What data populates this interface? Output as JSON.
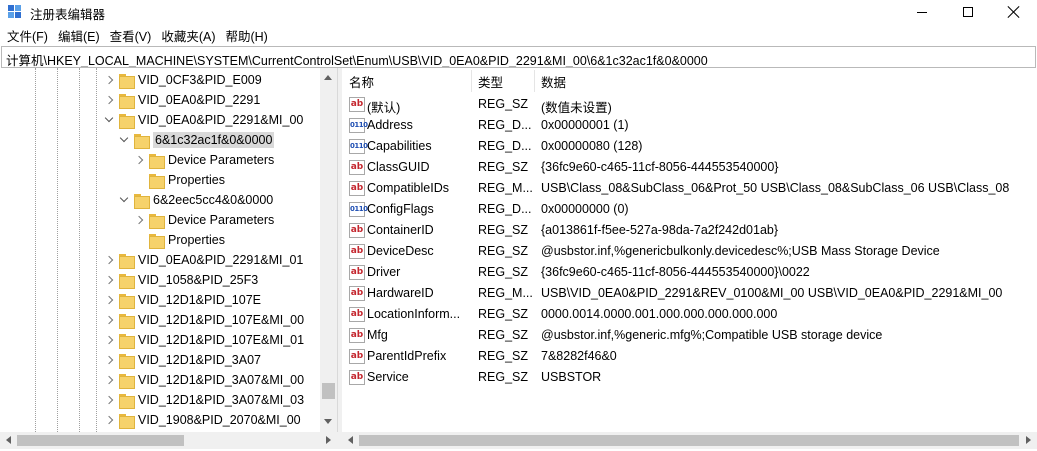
{
  "window": {
    "title": "注册表编辑器",
    "app_icon": "regedit-icon",
    "controls": [
      "minimize-icon",
      "maximize-icon",
      "close-icon"
    ]
  },
  "menu": [
    "文件(F)",
    "编辑(E)",
    "查看(V)",
    "收藏夹(A)",
    "帮助(H)"
  ],
  "address": "计算机\\HKEY_LOCAL_MACHINE\\SYSTEM\\CurrentControlSet\\Enum\\USB\\VID_0EA0&PID_2291&MI_00\\6&1c32ac1f&0&0000",
  "tree": [
    {
      "label": "VID_0CF3&PID_E009",
      "depth": 0,
      "expander": "right",
      "selected": false
    },
    {
      "label": "VID_0EA0&PID_2291",
      "depth": 0,
      "expander": "right",
      "selected": false
    },
    {
      "label": "VID_0EA0&PID_2291&MI_00",
      "depth": 0,
      "expander": "down",
      "selected": false
    },
    {
      "label": "6&1c32ac1f&0&0000",
      "depth": 1,
      "expander": "down",
      "selected": true
    },
    {
      "label": "Device Parameters",
      "depth": 2,
      "expander": "right",
      "selected": false
    },
    {
      "label": "Properties",
      "depth": 2,
      "expander": "none",
      "selected": false
    },
    {
      "label": "6&2eec5cc4&0&0000",
      "depth": 1,
      "expander": "down",
      "selected": false
    },
    {
      "label": "Device Parameters",
      "depth": 2,
      "expander": "right",
      "selected": false
    },
    {
      "label": "Properties",
      "depth": 2,
      "expander": "none",
      "selected": false
    },
    {
      "label": "VID_0EA0&PID_2291&MI_01",
      "depth": 0,
      "expander": "right",
      "selected": false
    },
    {
      "label": "VID_1058&PID_25F3",
      "depth": 0,
      "expander": "right",
      "selected": false
    },
    {
      "label": "VID_12D1&PID_107E",
      "depth": 0,
      "expander": "right",
      "selected": false
    },
    {
      "label": "VID_12D1&PID_107E&MI_00",
      "depth": 0,
      "expander": "right",
      "selected": false
    },
    {
      "label": "VID_12D1&PID_107E&MI_01",
      "depth": 0,
      "expander": "right",
      "selected": false
    },
    {
      "label": "VID_12D1&PID_3A07",
      "depth": 0,
      "expander": "right",
      "selected": false
    },
    {
      "label": "VID_12D1&PID_3A07&MI_00",
      "depth": 0,
      "expander": "right",
      "selected": false
    },
    {
      "label": "VID_12D1&PID_3A07&MI_03",
      "depth": 0,
      "expander": "right",
      "selected": false
    },
    {
      "label": "VID_1908&PID_2070&MI_00",
      "depth": 0,
      "expander": "right",
      "selected": false
    }
  ],
  "columns": {
    "name": "名称",
    "type": "类型",
    "data": "数据"
  },
  "values": [
    {
      "icon": "string-value-icon",
      "icon_text": "ab",
      "name": "(默认)",
      "type": "REG_SZ",
      "data": "(数值未设置)"
    },
    {
      "icon": "binary-value-icon",
      "icon_text": "011 110",
      "name": "Address",
      "type": "REG_D...",
      "data": "0x00000001 (1)"
    },
    {
      "icon": "binary-value-icon",
      "icon_text": "011 110",
      "name": "Capabilities",
      "type": "REG_D...",
      "data": "0x00000080 (128)"
    },
    {
      "icon": "string-value-icon",
      "icon_text": "ab",
      "name": "ClassGUID",
      "type": "REG_SZ",
      "data": "{36fc9e60-c465-11cf-8056-444553540000}"
    },
    {
      "icon": "string-value-icon",
      "icon_text": "ab",
      "name": "CompatibleIDs",
      "type": "REG_M...",
      "data": "USB\\Class_08&SubClass_06&Prot_50 USB\\Class_08&SubClass_06 USB\\Class_08"
    },
    {
      "icon": "binary-value-icon",
      "icon_text": "011 110",
      "name": "ConfigFlags",
      "type": "REG_D...",
      "data": "0x00000000 (0)"
    },
    {
      "icon": "string-value-icon",
      "icon_text": "ab",
      "name": "ContainerID",
      "type": "REG_SZ",
      "data": "{a013861f-f5ee-527a-98da-7a2f242d01ab}"
    },
    {
      "icon": "string-value-icon",
      "icon_text": "ab",
      "name": "DeviceDesc",
      "type": "REG_SZ",
      "data": "@usbstor.inf,%genericbulkonly.devicedesc%;USB Mass Storage Device"
    },
    {
      "icon": "string-value-icon",
      "icon_text": "ab",
      "name": "Driver",
      "type": "REG_SZ",
      "data": "{36fc9e60-c465-11cf-8056-444553540000}\\0022"
    },
    {
      "icon": "string-value-icon",
      "icon_text": "ab",
      "name": "HardwareID",
      "type": "REG_M...",
      "data": "USB\\VID_0EA0&PID_2291&REV_0100&MI_00 USB\\VID_0EA0&PID_2291&MI_00"
    },
    {
      "icon": "string-value-icon",
      "icon_text": "ab",
      "name": "LocationInform...",
      "type": "REG_SZ",
      "data": "0000.0014.0000.001.000.000.000.000.000"
    },
    {
      "icon": "string-value-icon",
      "icon_text": "ab",
      "name": "Mfg",
      "type": "REG_SZ",
      "data": "@usbstor.inf,%generic.mfg%;Compatible USB storage device"
    },
    {
      "icon": "string-value-icon",
      "icon_text": "ab",
      "name": "ParentIdPrefix",
      "type": "REG_SZ",
      "data": "7&8282f46&0"
    },
    {
      "icon": "string-value-icon",
      "icon_text": "ab",
      "name": "Service",
      "type": "REG_SZ",
      "data": "USBSTOR"
    }
  ]
}
